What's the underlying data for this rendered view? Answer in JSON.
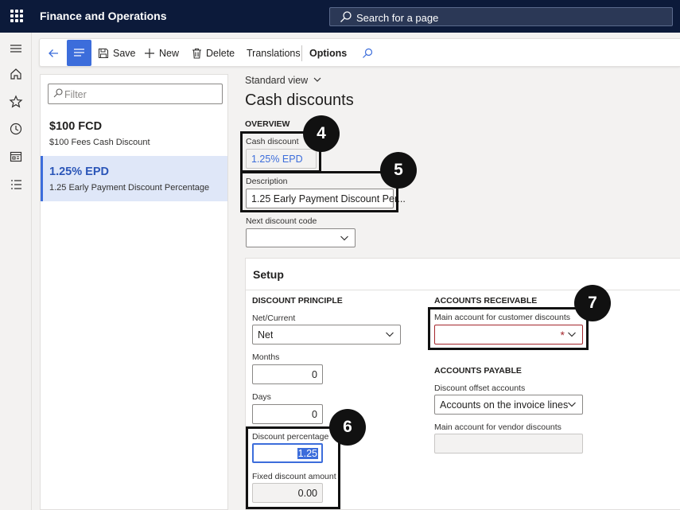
{
  "app": {
    "title": "Finance and Operations"
  },
  "search": {
    "placeholder": "Search for a page"
  },
  "actions": {
    "save": "Save",
    "new": "New",
    "delete": "Delete",
    "translations": "Translations",
    "options": "Options"
  },
  "list": {
    "filter_placeholder": "Filter",
    "items": [
      {
        "code": "$100 FCD",
        "description": "$100 Fees Cash Discount",
        "selected": false
      },
      {
        "code": "1.25% EPD",
        "description": "1.25 Early Payment Discount Percentage",
        "selected": true
      }
    ]
  },
  "page": {
    "view": "Standard view",
    "title": "Cash discounts"
  },
  "overview": {
    "heading": "OVERVIEW",
    "cash_discount_label": "Cash discount",
    "cash_discount_value": "1.25% EPD",
    "description_label": "Description",
    "description_value": "1.25 Early Payment Discount Per...",
    "next_code_label": "Next discount code",
    "next_code_value": ""
  },
  "setup": {
    "title": "Setup",
    "principle_heading": "DISCOUNT PRINCIPLE",
    "net_current_label": "Net/Current",
    "net_current_value": "Net",
    "months_label": "Months",
    "months_value": "0",
    "days_label": "Days",
    "days_value": "0",
    "discount_pct_label": "Discount percentage",
    "discount_pct_value": "1.25",
    "fixed_amount_label": "Fixed discount amount",
    "fixed_amount_value": "0.00",
    "ar_heading": "ACCOUNTS RECEIVABLE",
    "main_customer_label": "Main account for customer discounts",
    "required_mark": "*",
    "ap_heading": "ACCOUNTS PAYABLE",
    "offset_label": "Discount offset accounts",
    "offset_value": "Accounts on the invoice lines",
    "main_vendor_label": "Main account for vendor discounts",
    "main_vendor_value": ""
  },
  "callouts": {
    "b4": "4",
    "b5": "5",
    "b6": "6",
    "b7": "7"
  },
  "colors": {
    "nav": "#0c1a3a",
    "accent": "#3c6ddb",
    "selected_row": "#dfe7f8",
    "required": "#a4262c"
  }
}
